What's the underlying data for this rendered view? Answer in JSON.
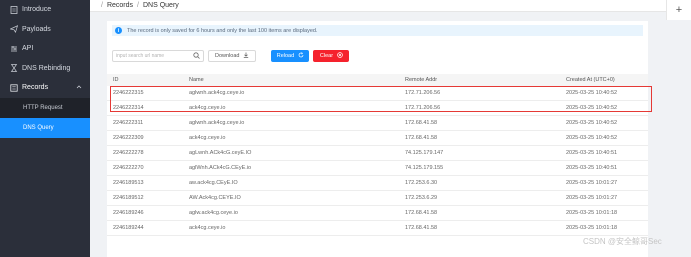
{
  "sidebar": {
    "items": [
      {
        "label": "Introduce",
        "icon": "document-icon"
      },
      {
        "label": "Payloads",
        "icon": "send-icon"
      },
      {
        "label": "API",
        "icon": "api-icon"
      },
      {
        "label": "DNS Rebinding",
        "icon": "hourglass-icon"
      }
    ],
    "records": {
      "label": "Records",
      "icon": "records-icon"
    },
    "submenu": [
      {
        "label": "HTTP Request"
      },
      {
        "label": "DNS Query"
      }
    ]
  },
  "header": {
    "breadcrumb_root": "Records",
    "breadcrumb_current": "DNS Query",
    "corner_symbol": "+"
  },
  "notice": {
    "text": "The record is only saved for 6 hours and only the last 100 items are displayed."
  },
  "toolbar": {
    "search_placeholder": "input search url name",
    "download_label": "Download",
    "reload_label": "Reload",
    "clear_label": "Clear"
  },
  "table": {
    "headers": [
      "ID",
      "Name",
      "Remote Addr",
      "Created At (UTC+0)"
    ],
    "rows": [
      [
        "2246222315",
        "aglwnh.ack4cg.ceye.io",
        "172.71.206.56",
        "2025-03-25 10:40:52"
      ],
      [
        "2246222314",
        "ack4cg.ceye.io",
        "172.71.206.56",
        "2025-03-25 10:40:52"
      ],
      [
        "2246222311",
        "aglwnh.ack4cg.ceye.io",
        "172.68.41.58",
        "2025-03-25 10:40:52"
      ],
      [
        "2246222309",
        "ack4cg.ceye.io",
        "172.68.41.58",
        "2025-03-25 10:40:52"
      ],
      [
        "2246222278",
        "agLwnh.ACk4cG.ceyE.IO",
        "74.125.179.147",
        "2025-03-25 10:40:51"
      ],
      [
        "2246222270",
        "aglWnh.ACk4cG.CEyE.io",
        "74.125.179.155",
        "2025-03-25 10:40:51"
      ],
      [
        "2246189513",
        "aw.ack4cg.CEyE.IO",
        "172.253.6.30",
        "2025-03-25 10:01:27"
      ],
      [
        "2246189512",
        "AW.Ack4cg.CEYE.IO",
        "172.253.6.29",
        "2025-03-25 10:01:27"
      ],
      [
        "2246189246",
        "aglw.ack4cg.ceye.io",
        "172.68.41.58",
        "2025-03-25 10:01:18"
      ],
      [
        "2246189244",
        "ack4cg.ceye.io",
        "172.68.41.58",
        "2025-03-25 10:01:18"
      ]
    ]
  },
  "watermark": "CSDN @安全鲸哥Sec",
  "colors": {
    "sidebar_bg": "#2b2f3a",
    "active_item": "#1890ff",
    "reload_button": "#1890ff",
    "clear_button": "#f5222d",
    "highlight_box": "#e53935"
  }
}
